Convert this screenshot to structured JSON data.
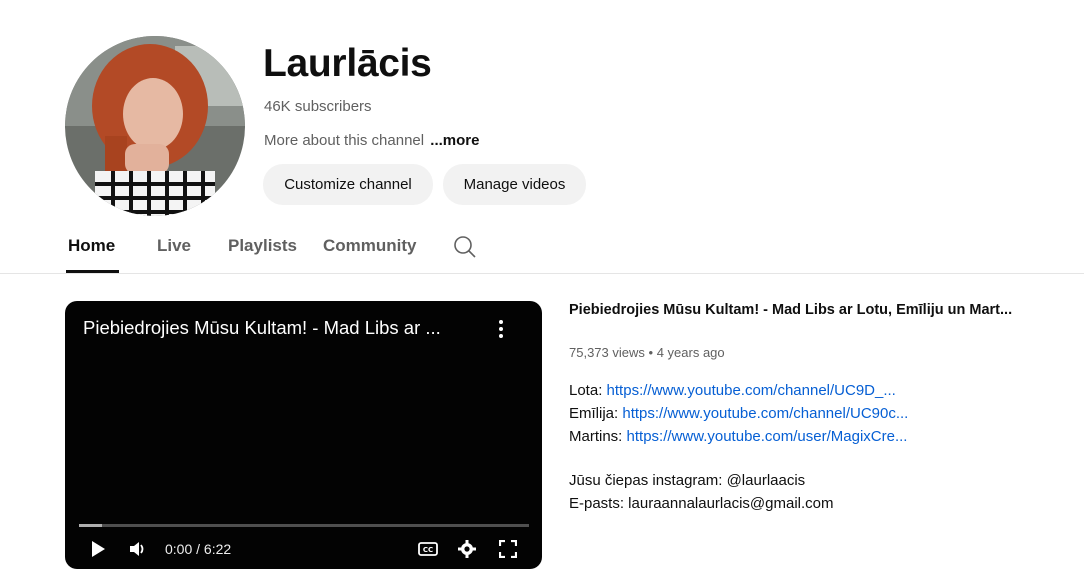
{
  "channel": {
    "name": "Laurlācis",
    "subscribers": "46K subscribers",
    "about": "More about this channel",
    "more_label": "...more",
    "customize_label": "Customize channel",
    "manage_label": "Manage videos"
  },
  "tabs": [
    {
      "label": "Home",
      "active": true
    },
    {
      "label": "Live"
    },
    {
      "label": "Playlists"
    },
    {
      "label": "Community"
    }
  ],
  "player": {
    "title": "Piebiedrojies Mūsu Kultam! - Mad Libs ar ...",
    "time": "0:00 / 6:22",
    "progress_loaded_fraction": 0.05
  },
  "video": {
    "title": "Piebiedrojies Mūsu Kultam! - Mad Libs ar Lotu, Emīliju un Mart...",
    "views": "75,373 views",
    "separator": "•",
    "age": "4 years ago",
    "links": [
      {
        "prefix": "Lota:",
        "url": "https://www.youtube.com/channel/UC9D_..."
      },
      {
        "prefix": "Emīlija:",
        "url": "https://www.youtube.com/channel/UC90c..."
      },
      {
        "prefix": "Martins:",
        "url": "https://www.youtube.com/user/MagixCre..."
      }
    ],
    "instagram_line": "Jūsu čiepas instagram:  @laurlaacis",
    "email_line": "E-pasts: lauraannalaurlacis@gmail.com"
  },
  "colors": {
    "link": "#065fd4",
    "muted_text": "#606060",
    "pill_bg": "#f2f2f2",
    "player_bg": "#030303"
  }
}
